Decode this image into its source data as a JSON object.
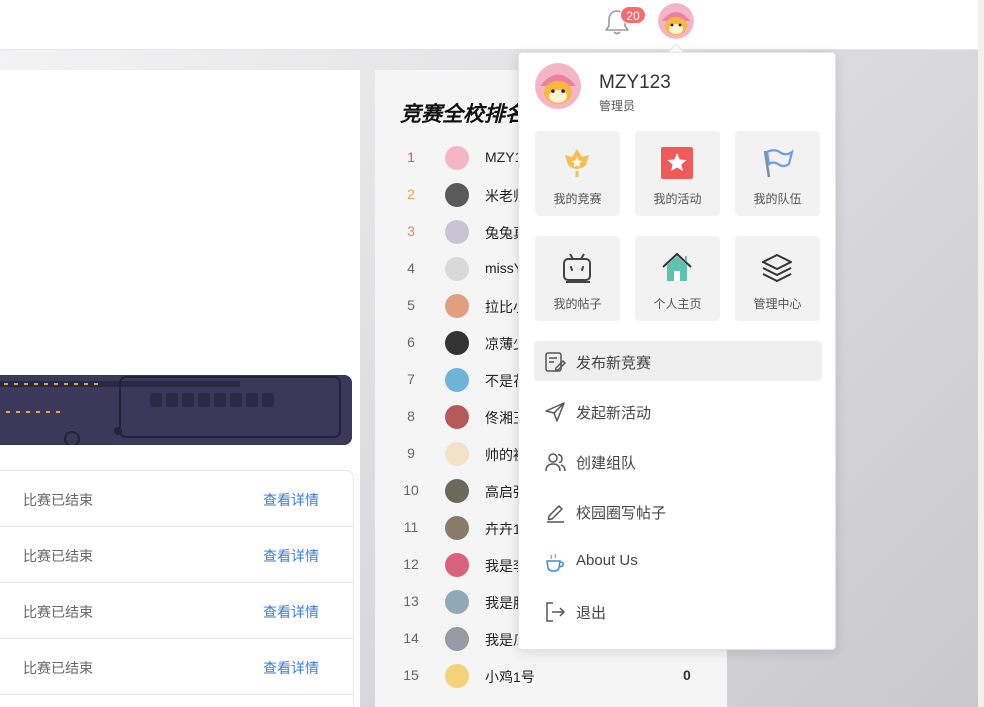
{
  "header": {
    "notification_count": "20"
  },
  "left": {
    "results": [
      {
        "status": "比赛已结束",
        "link": "查看详情"
      },
      {
        "status": "比赛已结束",
        "link": "查看详情"
      },
      {
        "status": "比赛已结束",
        "link": "查看详情"
      },
      {
        "status": "比赛已结束",
        "link": "查看详情"
      }
    ]
  },
  "ranking": {
    "title": "竞赛全校排名",
    "rows": [
      {
        "rank": "1",
        "name": "MZY1",
        "color": "#e05353"
      },
      {
        "rank": "2",
        "name": "米老师",
        "color": "#e8a33c"
      },
      {
        "rank": "3",
        "name": "兔兔真",
        "color": "#d98c6a"
      },
      {
        "rank": "4",
        "name": "missY",
        "color": "#666666"
      },
      {
        "rank": "5",
        "name": "拉比小",
        "color": "#666666"
      },
      {
        "rank": "6",
        "name": "凉薄少",
        "color": "#666666"
      },
      {
        "rank": "7",
        "name": "不是花",
        "color": "#666666"
      },
      {
        "rank": "8",
        "name": "佟湘玉",
        "color": "#666666"
      },
      {
        "rank": "9",
        "name": "帅的被",
        "color": "#666666"
      },
      {
        "rank": "10",
        "name": "高启强",
        "color": "#666666"
      },
      {
        "rank": "11",
        "name": "卉卉1",
        "color": "#666666"
      },
      {
        "rank": "12",
        "name": "我是李",
        "color": "#666666"
      },
      {
        "rank": "13",
        "name": "我是胖",
        "color": "#666666"
      },
      {
        "rank": "14",
        "name": "我是瓜",
        "color": "#666666"
      },
      {
        "rank": "15",
        "name": "小鸡1号",
        "color": "#666666",
        "score": "0"
      }
    ]
  },
  "dropdown": {
    "username": "MZY123",
    "role": "管理员",
    "tiles": [
      {
        "label": "我的竞赛",
        "icon": "trophy-flower-icon"
      },
      {
        "label": "我的活动",
        "icon": "star-icon"
      },
      {
        "label": "我的队伍",
        "icon": "flag-icon"
      },
      {
        "label": "我的帖子",
        "icon": "tv-post-icon"
      },
      {
        "label": "个人主页",
        "icon": "home-icon"
      },
      {
        "label": "管理中心",
        "icon": "layers-icon"
      }
    ],
    "menu": [
      {
        "label": "发布新竞赛",
        "icon": "edit-document-icon"
      },
      {
        "label": "发起新活动",
        "icon": "send-icon"
      },
      {
        "label": "创建组队",
        "icon": "users-icon"
      },
      {
        "label": "校园圈写帖子",
        "icon": "pen-icon"
      },
      {
        "label": "About Us",
        "icon": "coffee-cup-icon"
      },
      {
        "label": "退出",
        "icon": "logout-icon"
      }
    ]
  },
  "colors": {
    "accent_link": "#3a7bd5",
    "badge": "#f56c6c",
    "rank_first": "#e05353",
    "rank_second": "#e8a33c",
    "rank_third": "#d98c6a"
  }
}
